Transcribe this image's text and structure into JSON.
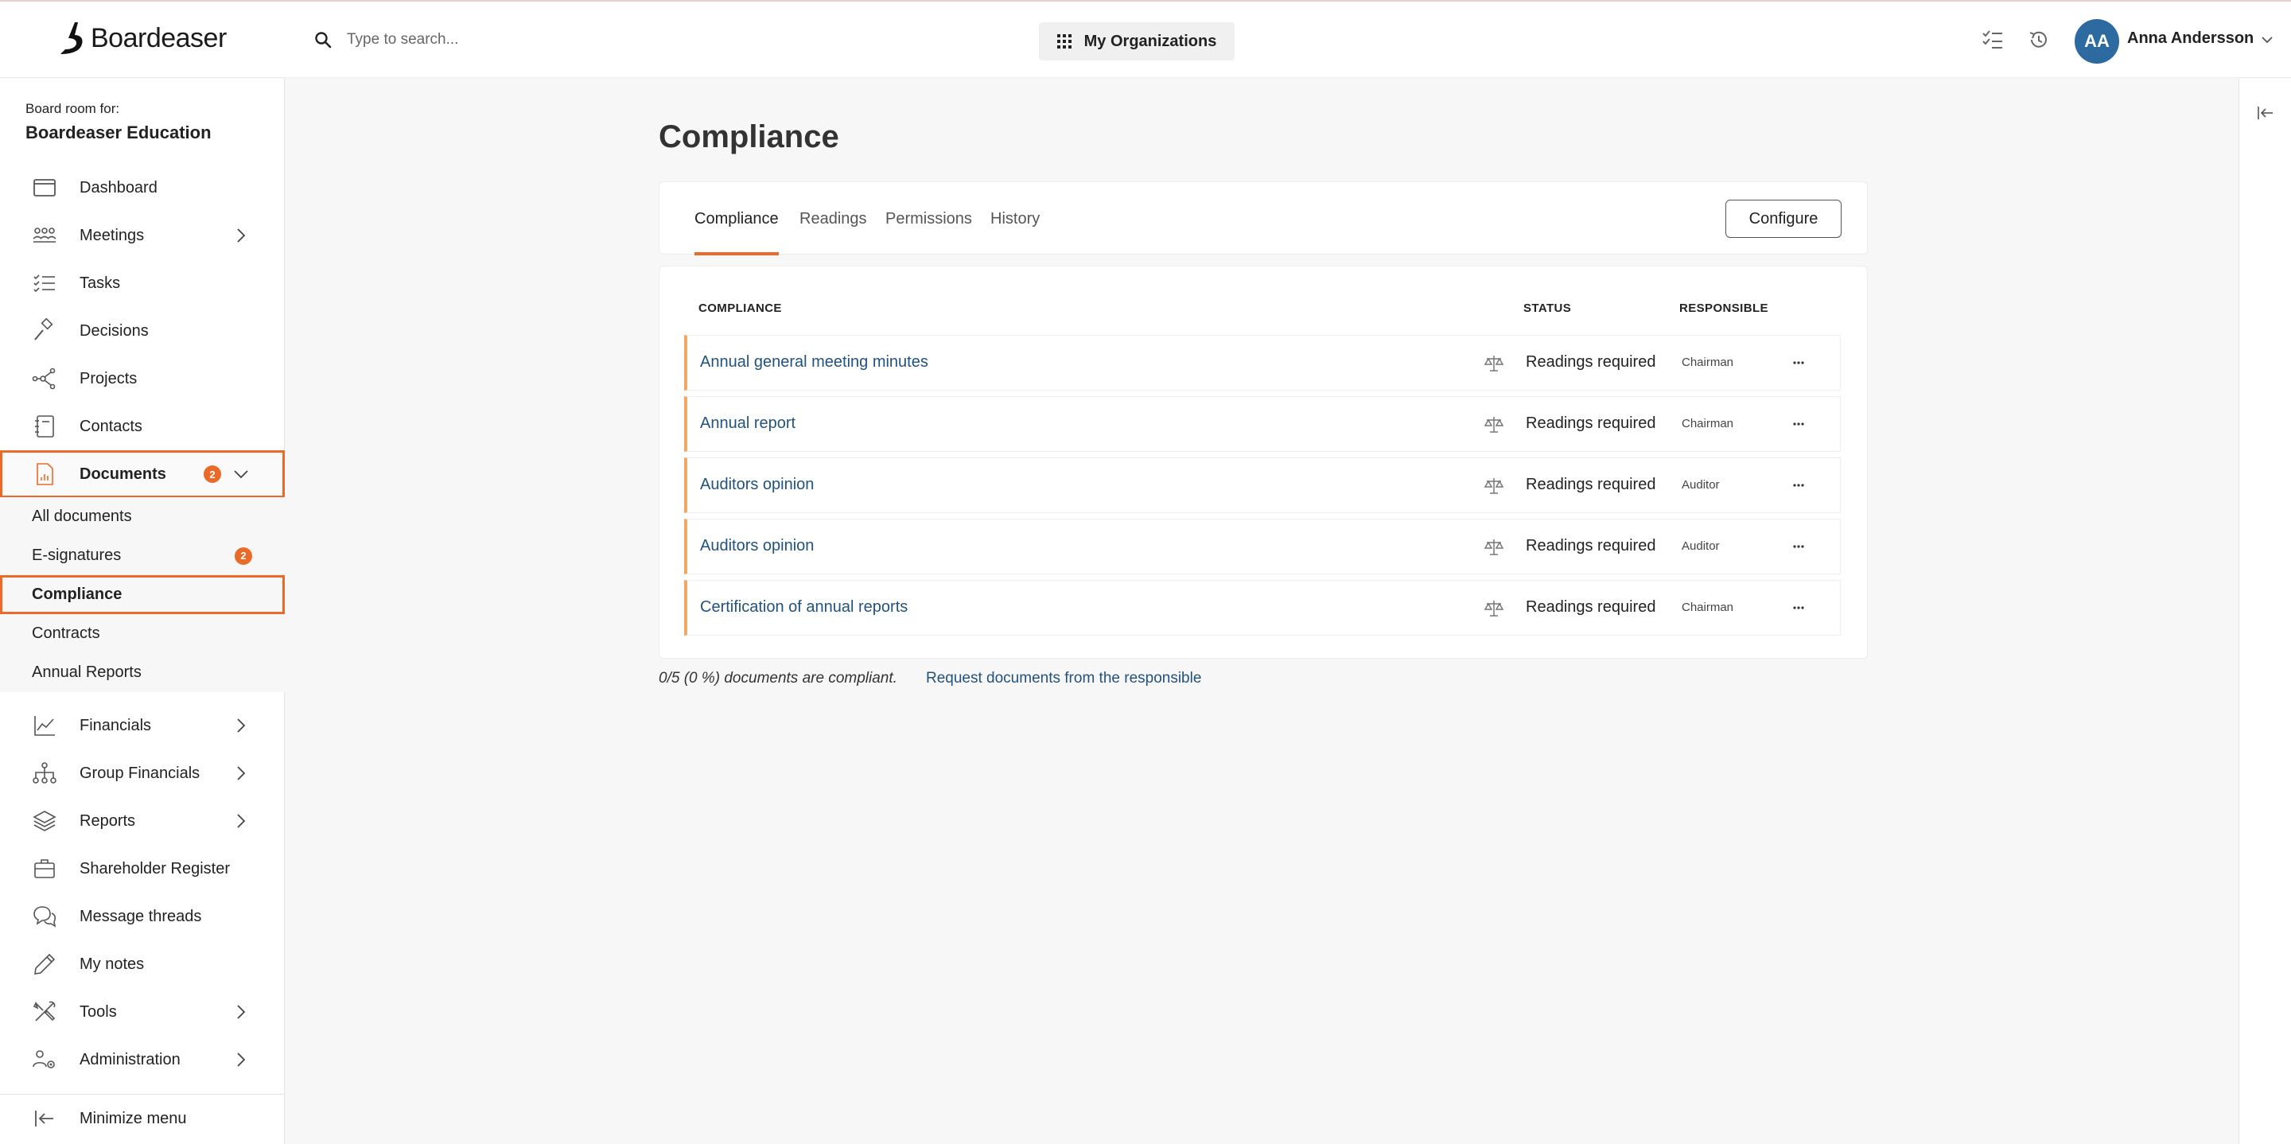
{
  "app": {
    "logo_text": "Boardeaser",
    "search_placeholder": "Type to search...",
    "org_button": "My Organizations",
    "user_initials": "AA",
    "user_name": "Anna Andersson",
    "accent_color": "#ea6a2a",
    "link_color": "#23527c"
  },
  "sidebar": {
    "board_for": "Board room for:",
    "board_name": "Boardeaser Education",
    "items": [
      {
        "label": "Dashboard",
        "icon": "dashboard-icon"
      },
      {
        "label": "Meetings",
        "icon": "meetings-icon"
      },
      {
        "label": "Tasks",
        "icon": "tasks-icon"
      },
      {
        "label": "Decisions",
        "icon": "gavel-icon"
      },
      {
        "label": "Projects",
        "icon": "projects-icon"
      },
      {
        "label": "Contacts",
        "icon": "contacts-icon"
      },
      {
        "label": "Documents",
        "icon": "document-icon",
        "badge": "2"
      },
      {
        "label": "Financials",
        "icon": "chart-line-icon"
      },
      {
        "label": "Group Financials",
        "icon": "hierarchy-icon"
      },
      {
        "label": "Reports",
        "icon": "layers-icon"
      },
      {
        "label": "Shareholder Register",
        "icon": "briefcase-icon"
      },
      {
        "label": "Message threads",
        "icon": "chat-icon"
      },
      {
        "label": "My notes",
        "icon": "pencil-icon"
      },
      {
        "label": "Tools",
        "icon": "tools-icon"
      },
      {
        "label": "Administration",
        "icon": "users-gear-icon"
      }
    ],
    "documents_sub": [
      {
        "label": "All documents"
      },
      {
        "label": "E-signatures",
        "badge": "2"
      },
      {
        "label": "Compliance"
      },
      {
        "label": "Contracts"
      },
      {
        "label": "Annual Reports"
      }
    ],
    "minimize": "Minimize menu"
  },
  "main": {
    "title": "Compliance",
    "tabs": [
      "Compliance",
      "Readings",
      "Permissions",
      "History"
    ],
    "configure": "Configure",
    "columns": {
      "compliance": "COMPLIANCE",
      "status": "STATUS",
      "responsible": "RESPONSIBLE"
    },
    "rows": [
      {
        "name": "Annual general meeting minutes",
        "status": "Readings required",
        "responsible": "Chairman"
      },
      {
        "name": "Annual report",
        "status": "Readings required",
        "responsible": "Chairman"
      },
      {
        "name": "Auditors opinion",
        "status": "Readings required",
        "responsible": "Auditor"
      },
      {
        "name": "Auditors opinion",
        "status": "Readings required",
        "responsible": "Auditor"
      },
      {
        "name": "Certification of annual reports",
        "status": "Readings required",
        "responsible": "Chairman"
      }
    ],
    "summary": "0/5 (0 %) documents are compliant.",
    "request_link": "Request documents from the responsible"
  }
}
